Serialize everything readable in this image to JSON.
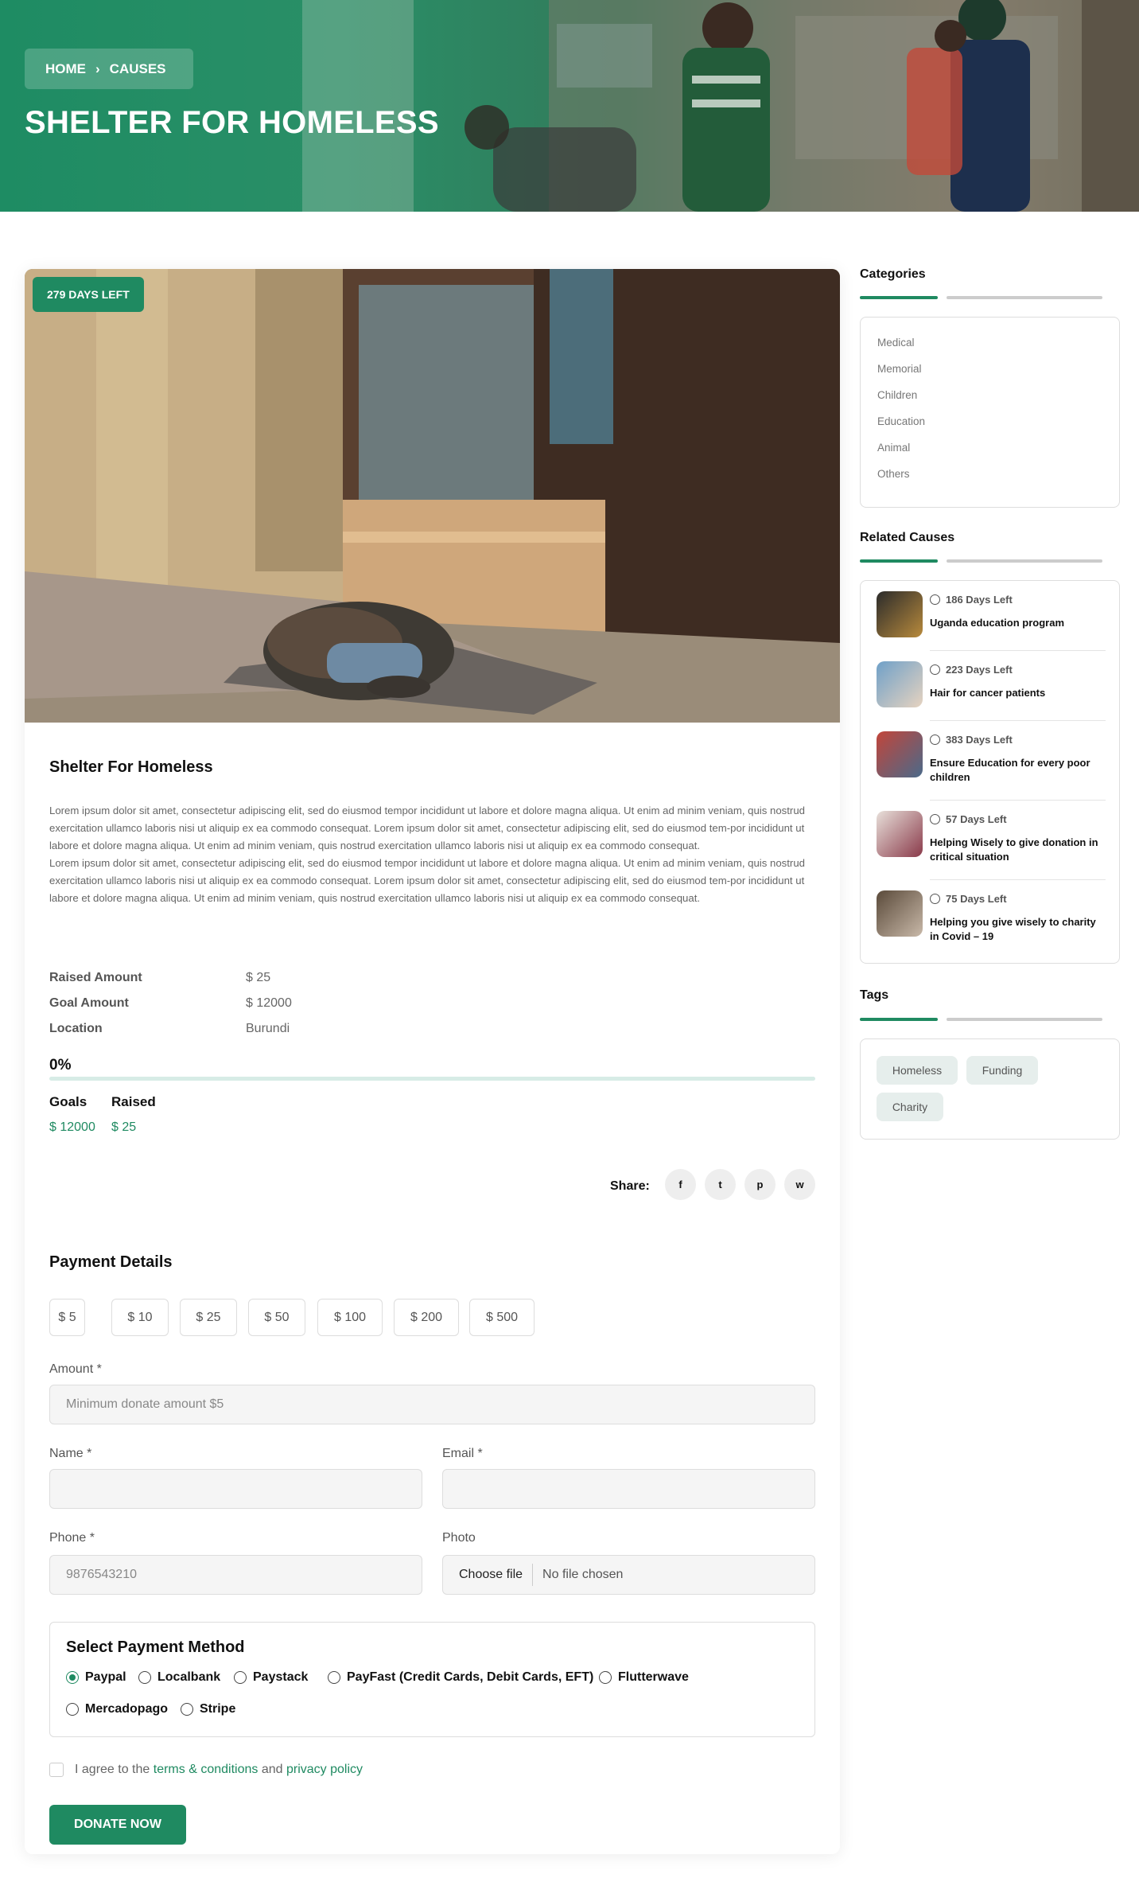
{
  "hero": {
    "breadcrumb": [
      "HOME",
      "CAUSES"
    ],
    "breadcrumb_sep": "›",
    "title": "SHELTER FOR HOMELESS"
  },
  "cause": {
    "days_left_badge": "279 DAYS LEFT",
    "title": "Shelter For Homeless",
    "description_1": "Lorem ipsum dolor sit amet, consectetur adipiscing elit, sed do eiusmod tempor incididunt ut labore et dolore magna aliqua. Ut enim ad minim veniam, quis nostrud exercitation ullamco laboris nisi ut aliquip ex ea commodo consequat. Lorem ipsum dolor sit amet, consectetur adipiscing elit, sed do eiusmod tem-por incididunt ut labore et dolore magna aliqua. Ut enim ad minim veniam, quis nostrud exercitation ullamco laboris nisi ut aliquip ex ea commodo consequat.",
    "description_2": "Lorem ipsum dolor sit amet, consectetur adipiscing elit, sed do eiusmod tempor incididunt ut labore et dolore magna aliqua. Ut enim ad minim veniam, quis nostrud exercitation ullamco laboris nisi ut aliquip ex ea commodo consequat. Lorem ipsum dolor sit amet, consectetur adipiscing elit, sed do eiusmod tem-por incididunt ut labore et dolore magna aliqua. Ut enim ad minim veniam, quis nostrud exercitation ullamco laboris nisi ut aliquip ex ea commodo consequat.",
    "info": [
      {
        "label": "Raised Amount",
        "value": "$ 25"
      },
      {
        "label": "Goal Amount",
        "value": "$ 12000"
      },
      {
        "label": "Location",
        "value": "Burundi"
      }
    ],
    "progress_text": "0%",
    "progress_value": 0,
    "goals_label": "Goals",
    "goals_value": "$ 12000",
    "raised_label": "Raised",
    "raised_value": "$ 25",
    "share_label": "Share:",
    "share_icons": [
      "facebook-icon",
      "twitter-icon",
      "pinterest-icon",
      "whatsapp-icon"
    ],
    "share_glyphs": [
      "f",
      "t",
      "p",
      "w"
    ]
  },
  "payment": {
    "title": "Payment Details",
    "amounts": [
      "$ 5",
      "$ 10",
      "$ 25",
      "$ 50",
      "$ 100",
      "$ 200",
      "$ 500"
    ],
    "amount_label": "Amount *",
    "amount_placeholder": "Minimum donate amount $5",
    "name_label": "Name *",
    "email_label": "Email *",
    "phone_label": "Phone *",
    "phone_placeholder": "9876543210",
    "photo_label": "Photo",
    "file_button": "Choose file",
    "file_status": "No file chosen",
    "method_title": "Select Payment Method",
    "methods": [
      "Paypal",
      "Localbank",
      "Paystack",
      "PayFast (Credit Cards, Debit Cards, EFT)",
      "Flutterwave",
      "Mercadopago",
      "Stripe"
    ],
    "selected_method": "Paypal",
    "agree_prefix": "I agree to the",
    "terms_link": "terms & conditions",
    "agree_and": "and",
    "privacy_link": "privacy policy",
    "donate_button": "DONATE NOW"
  },
  "sidebar": {
    "categories_title": "Categories",
    "categories": [
      "Medical",
      "Memorial",
      "Children",
      "Education",
      "Animal",
      "Others"
    ],
    "related_title": "Related Causes",
    "related": [
      {
        "days": "186 Days Left",
        "title": "Uganda education program"
      },
      {
        "days": "223 Days Left",
        "title": "Hair for cancer patients"
      },
      {
        "days": "383 Days Left",
        "title": "Ensure Education for every poor children"
      },
      {
        "days": "57 Days Left",
        "title": "Helping Wisely to give donation in critical situation"
      },
      {
        "days": "75 Days Left",
        "title": "Helping you give wisely to charity in Covid – 19"
      }
    ],
    "tags_title": "Tags",
    "tags": [
      "Homeless",
      "Funding",
      "Charity"
    ]
  },
  "colors": {
    "accent": "#1f8a61"
  }
}
